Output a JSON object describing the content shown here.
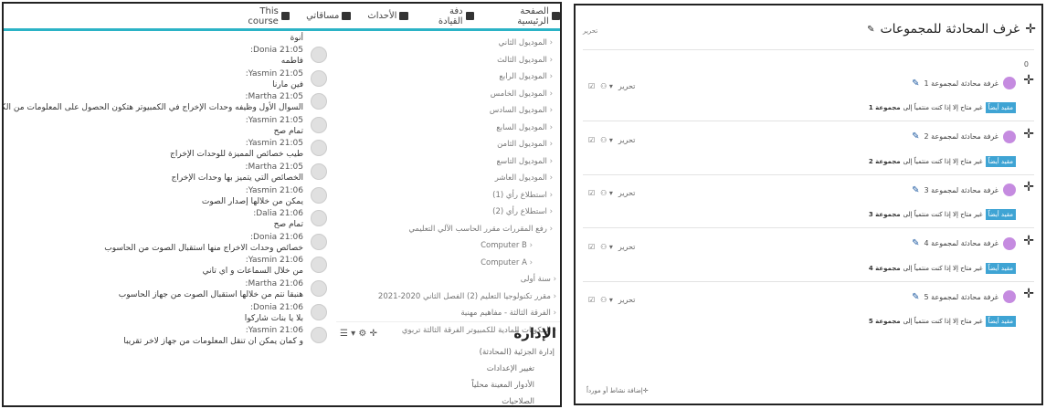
{
  "left_panel": {
    "topbar": [
      {
        "icon": "home-icon",
        "label": "الصفحة الرئيسية"
      },
      {
        "icon": "dashboard-icon",
        "label": "دفة القيادة"
      },
      {
        "icon": "calendar-icon",
        "label": "الأحداث"
      },
      {
        "icon": "briefcase-icon",
        "label": "مساقاتي"
      },
      {
        "icon": "sitemap-icon",
        "label": "This course"
      }
    ],
    "chat": [
      {
        "meta": "",
        "text": "أنوة"
      },
      {
        "meta": "Donia 21:05:",
        "text": "فاطمه"
      },
      {
        "meta": "Yasmin 21:05:",
        "text": "فين مارنا"
      },
      {
        "meta": "Martha 21:05:",
        "text": "السوال الأول وظيفه وحدات الإخراج في الكمبيوتر هتكون الحصول على المعلومات من الكمبيوتر"
      },
      {
        "meta": "Yasmin 21:05:",
        "text": "تمام صح"
      },
      {
        "meta": "Yasmin 21:05:",
        "text": "طيب خصائص المميزة للوحدات الإخراج"
      },
      {
        "meta": "Martha 21:05:",
        "text": "الخصائص التي يتميز بها وحدات الإخراج"
      },
      {
        "meta": "Yasmin 21:06:",
        "text": "يمكن من خلالها إصدار الصوت"
      },
      {
        "meta": "Dalia 21:06:",
        "text": "تمام صح"
      },
      {
        "meta": "Donia 21:06:",
        "text": "خصائص وحدات الاخراج منها استقبال الصوت من الحاسوب"
      },
      {
        "meta": "Yasmin 21:06:",
        "text": "من خلال السماعات و اي تاني"
      },
      {
        "meta": "Martha 21:06:",
        "text": "هنبقا نتم من خلالها استقبال الصوت من جهاز الحاسوب"
      },
      {
        "meta": "Donia 21:06:",
        "text": "بلا يا بنات شاركوا"
      },
      {
        "meta": "Yasmin 21:06:",
        "text": "و كمان يمكن ان تنقل المعلومات من جهاز لاخر تقريبا"
      }
    ],
    "nav": [
      {
        "label": "الموديول الثاني",
        "cls": ""
      },
      {
        "label": "الموديول الثالث",
        "cls": ""
      },
      {
        "label": "الموديول الرابع",
        "cls": ""
      },
      {
        "label": "الموديول الخامس",
        "cls": ""
      },
      {
        "label": "الموديول السادس",
        "cls": ""
      },
      {
        "label": "الموديول السابع",
        "cls": ""
      },
      {
        "label": "الموديول الثامن",
        "cls": ""
      },
      {
        "label": "الموديول التاسع",
        "cls": ""
      },
      {
        "label": "الموديول العاشر",
        "cls": ""
      },
      {
        "label": "استطلاع رأي (1)",
        "cls": ""
      },
      {
        "label": "استطلاع رأي (2)",
        "cls": ""
      },
      {
        "label": "رفع المقررات مقرر الحاسب الآلي التعليمي",
        "cls": ""
      },
      {
        "label": "Computer B",
        "cls": "sub"
      },
      {
        "label": "Computer A",
        "cls": "sub"
      },
      {
        "label": "سنة أولى",
        "cls": "top"
      },
      {
        "label": "مقرر تكنولوجيا التعليم (2) الفصل الثاني 2020-2021",
        "cls": "top"
      },
      {
        "label": "الفرقة الثالثة - مفاهيم مهنية",
        "cls": "top"
      },
      {
        "label": "المكونات المادية للكمبيوتر الفرقة الثالثة تربوي",
        "cls": "top"
      }
    ],
    "admin": {
      "title": "الإدارة",
      "tools": "☰ ▾ ⚙ ✛",
      "items": [
        {
          "label": "إدارة الجزئية (المحادثة)",
          "cls": "top"
        },
        {
          "label": "تغيير الإعدادات",
          "cls": ""
        },
        {
          "label": "الأدوار المعينة محلياً",
          "cls": ""
        },
        {
          "label": "الصلاحيات",
          "cls": ""
        }
      ]
    }
  },
  "right_panel": {
    "title": "غرف المحادثة للمجموعات",
    "edit_label": "تحرير",
    "zero": "0",
    "groups": [
      {
        "name": "غرفة محادثة لمجموعة 1",
        "note": "غير متاح إلا إذا كنت منتمياً إلى",
        "group": "مجموعة 1"
      },
      {
        "name": "غرفة محادثة لمجموعة 2",
        "note": "غير متاح إلا إذا كنت منتمياً إلى",
        "group": "مجموعة 2"
      },
      {
        "name": "غرفة محادثة لمجموعة 3",
        "note": "غير متاح إلا إذا كنت منتمياً إلى",
        "group": "مجموعة 3"
      },
      {
        "name": "غرفة محادثة لمجموعة 4",
        "note": "غير متاح إلا إذا كنت منتمياً إلى",
        "group": "مجموعة 4"
      },
      {
        "name": "غرفة محادثة لمجموعة 5",
        "note": "غير متاح إلا إذا كنت منتمياً إلى",
        "group": "مجموعة 5"
      }
    ],
    "badge_label": "مقيد أيضاً",
    "footer": "إضافة نشاط أو مورداً",
    "colors": {
      "accent": "#2bb3c6",
      "badge": "#3fa4d4",
      "group_icon": "#c58be0"
    }
  }
}
